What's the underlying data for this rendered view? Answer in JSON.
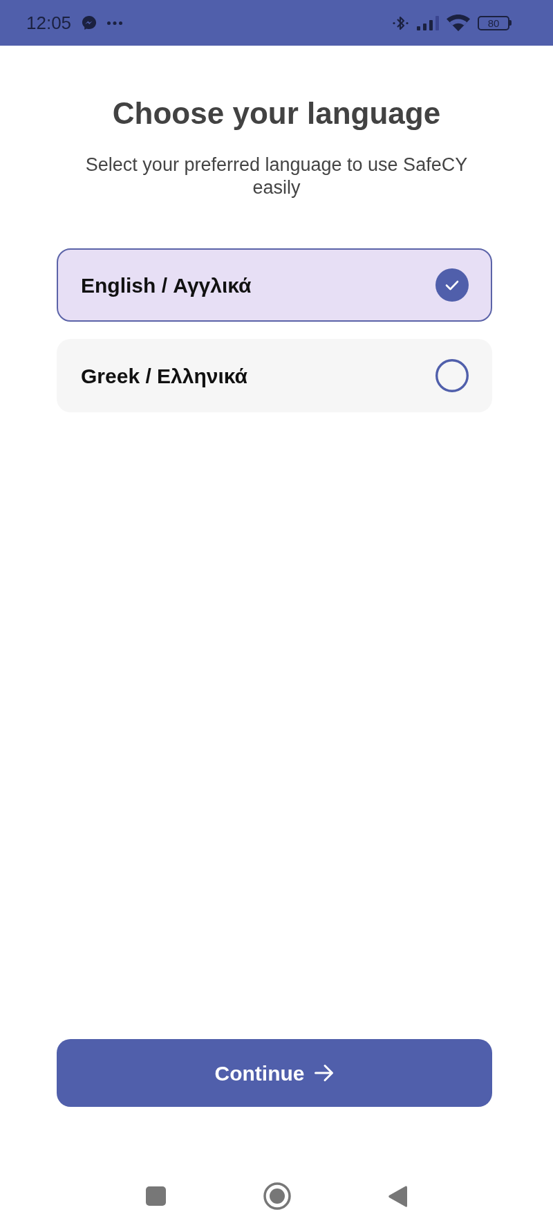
{
  "status_bar": {
    "time": "12:05",
    "battery": "80"
  },
  "header": {
    "title": "Choose your language",
    "subtitle": "Select your preferred language to use SafeCY easily"
  },
  "languages": [
    {
      "label": "English / Αγγλικά",
      "selected": true
    },
    {
      "label": "Greek / Ελληνικά",
      "selected": false
    }
  ],
  "continue_button": {
    "label": "Continue"
  }
}
